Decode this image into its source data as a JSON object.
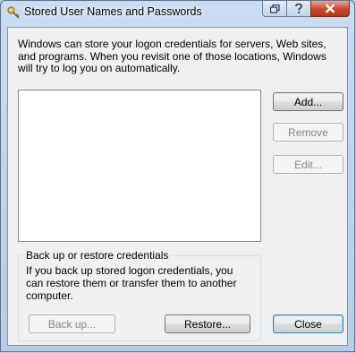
{
  "window": {
    "title": "Stored User Names and Passwords",
    "caption_icons": [
      "restore-window-icon",
      "help-icon",
      "close-icon"
    ]
  },
  "intro_text": "Windows can store your logon credentials for servers, Web sites, and programs. When you revisit one of those locations, Windows will try to log you on automatically.",
  "credentials": [],
  "buttons": {
    "add": "Add...",
    "remove": "Remove",
    "edit": "Edit...",
    "backup": "Back up...",
    "restore": "Restore...",
    "close": "Close"
  },
  "backup_group": {
    "label": "Back up or restore credentials",
    "text": "If you back up stored logon credentials, you can restore them or transfer them to another computer."
  },
  "colors": {
    "accent_close": "#c9452a",
    "default_button_border": "#3c7fb1"
  }
}
